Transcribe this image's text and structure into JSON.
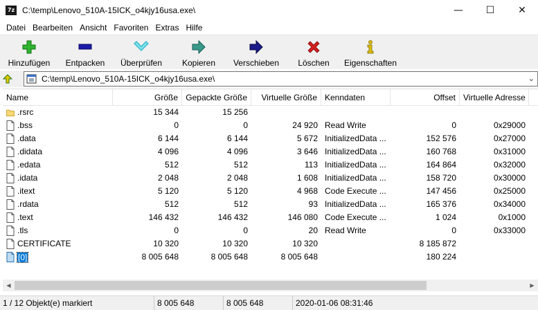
{
  "window": {
    "app_icon_text": "7z",
    "title": "C:\\temp\\Lenovo_510A-15ICK_o4kjy16usa.exe\\",
    "min_glyph": "—",
    "max_glyph": "☐",
    "close_glyph": "✕"
  },
  "menu": [
    "Datei",
    "Bearbeiten",
    "Ansicht",
    "Favoriten",
    "Extras",
    "Hilfe"
  ],
  "toolbar": [
    {
      "label": "Hinzufügen",
      "icon": "add-plus-icon",
      "color": "#2fb32f"
    },
    {
      "label": "Entpacken",
      "icon": "extract-minus-icon",
      "color": "#1c1ca8"
    },
    {
      "label": "Überprüfen",
      "icon": "test-check-icon",
      "color": "#28b4c8"
    },
    {
      "label": "Kopieren",
      "icon": "copy-arrow-icon",
      "color": "#1a8a7a"
    },
    {
      "label": "Verschieben",
      "icon": "move-arrow-icon",
      "color": "#1c1c8c"
    },
    {
      "label": "Löschen",
      "icon": "delete-x-icon",
      "color": "#d41e1e"
    },
    {
      "label": "Eigenschaften",
      "icon": "info-icon",
      "color": "#e0c000"
    }
  ],
  "address": {
    "path": "C:\\temp\\Lenovo_510A-15ICK_o4kjy16usa.exe\\"
  },
  "columns": [
    "Name",
    "Größe",
    "Gepackte Größe",
    "Virtuelle Größe",
    "Kenndaten",
    "Offset",
    "Virtuelle Adresse"
  ],
  "rows": [
    {
      "name": ".rsrc",
      "type": "folder",
      "size": "15 344",
      "packed": "15 256",
      "vsize": "",
      "char": "",
      "offset": "",
      "vaddr": ""
    },
    {
      "name": ".bss",
      "type": "file",
      "size": "0",
      "packed": "0",
      "vsize": "24 920",
      "char": "Read Write",
      "offset": "0",
      "vaddr": "0x29000"
    },
    {
      "name": ".data",
      "type": "file",
      "size": "6 144",
      "packed": "6 144",
      "vsize": "5 672",
      "char": "InitializedData ...",
      "offset": "152 576",
      "vaddr": "0x27000"
    },
    {
      "name": ".didata",
      "type": "file",
      "size": "4 096",
      "packed": "4 096",
      "vsize": "3 646",
      "char": "InitializedData ...",
      "offset": "160 768",
      "vaddr": "0x31000"
    },
    {
      "name": ".edata",
      "type": "file",
      "size": "512",
      "packed": "512",
      "vsize": "113",
      "char": "InitializedData ...",
      "offset": "164 864",
      "vaddr": "0x32000"
    },
    {
      "name": ".idata",
      "type": "file",
      "size": "2 048",
      "packed": "2 048",
      "vsize": "1 608",
      "char": "InitializedData ...",
      "offset": "158 720",
      "vaddr": "0x30000"
    },
    {
      "name": ".itext",
      "type": "file",
      "size": "5 120",
      "packed": "5 120",
      "vsize": "4 968",
      "char": "Code Execute ...",
      "offset": "147 456",
      "vaddr": "0x25000"
    },
    {
      "name": ".rdata",
      "type": "file",
      "size": "512",
      "packed": "512",
      "vsize": "93",
      "char": "InitializedData ...",
      "offset": "165 376",
      "vaddr": "0x34000"
    },
    {
      "name": ".text",
      "type": "file",
      "size": "146 432",
      "packed": "146 432",
      "vsize": "146 080",
      "char": "Code Execute ...",
      "offset": "1 024",
      "vaddr": "0x1000"
    },
    {
      "name": ".tls",
      "type": "file",
      "size": "0",
      "packed": "0",
      "vsize": "20",
      "char": "Read Write",
      "offset": "0",
      "vaddr": "0x33000"
    },
    {
      "name": "CERTIFICATE",
      "type": "file",
      "size": "10 320",
      "packed": "10 320",
      "vsize": "10 320",
      "char": "",
      "offset": "8 185 872",
      "vaddr": ""
    },
    {
      "name": "[0]",
      "type": "file-selected",
      "size": "8 005 648",
      "packed": "8 005 648",
      "vsize": "8 005 648",
      "char": "",
      "offset": "180 224",
      "vaddr": ""
    }
  ],
  "status": {
    "selection": "1 / 12 Objekt(e) markiert",
    "size": "8 005 648",
    "packed": "8 005 648",
    "modified": "2020-01-06 08:31:46"
  }
}
